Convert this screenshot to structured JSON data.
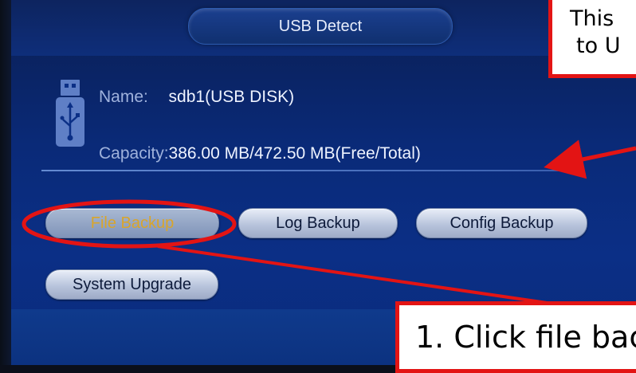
{
  "dialog": {
    "title": "USB Detect"
  },
  "device": {
    "name_label": "Name:",
    "name_value": "sdb1(USB DISK)",
    "capacity_label": "Capacity:",
    "capacity_value": "386.00 MB/472.50 MB(Free/Total)"
  },
  "buttons": {
    "file_backup": "File Backup",
    "log_backup": "Log Backup",
    "config_backup": "Config Backup",
    "system_upgrade": "System Upgrade"
  },
  "annotations": {
    "top_callout_line1": "This",
    "top_callout_line2": "to U",
    "bottom_callout": "1. Click file bac",
    "accent_color": "#e31414"
  },
  "icons": {
    "usb": "usb-drive-icon"
  }
}
